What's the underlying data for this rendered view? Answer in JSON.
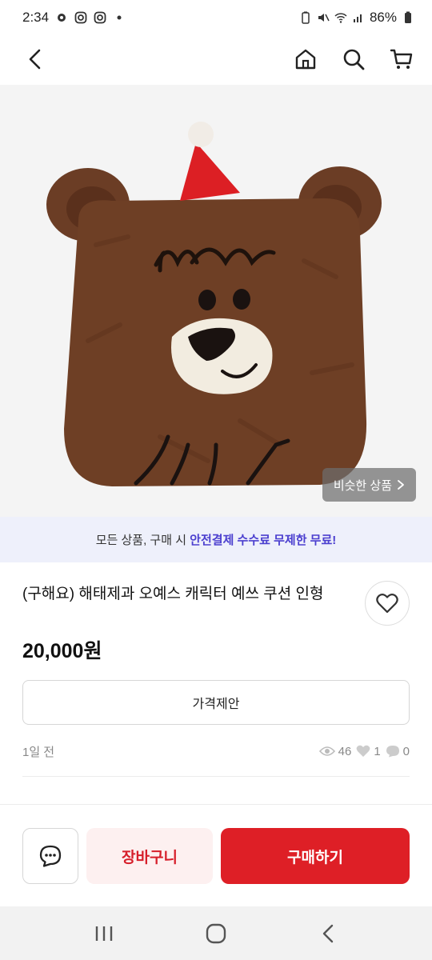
{
  "status_bar": {
    "time": "2:34",
    "battery": "86%",
    "left_icons": [
      "gear-icon",
      "instagram-icon",
      "instagram-icon",
      "dot-icon"
    ],
    "right_icons": [
      "battery-saver-icon",
      "mute-icon",
      "wifi-icon",
      "signal-icon",
      "battery-icon"
    ]
  },
  "nav": {
    "back_icon": "chevron-left-icon",
    "home_icon": "home-icon",
    "search_icon": "search-icon",
    "cart_icon": "cart-icon"
  },
  "product_image": {
    "similar_label": "비슷한 상품"
  },
  "promo": {
    "prefix": "모든 상품, 구매 시 ",
    "highlight": "안전결제 수수료 무제한 무료!",
    "highlight_color": "#4b3fcf"
  },
  "product": {
    "title": "(구해요) 해태제과 오예스 캐릭터 예쓰 쿠션 인형",
    "price": "20,000원",
    "offer_label": "가격제안",
    "posted": "1일 전",
    "views": "46",
    "likes": "1",
    "chats": "0"
  },
  "actions": {
    "chat_icon": "chat-icon",
    "cart_label": "장바구니",
    "buy_label": "구매하기",
    "buy_color": "#de1f26"
  },
  "android_nav": {
    "recents_icon": "recents-icon",
    "home_icon": "home-circle-icon",
    "back_icon": "back-icon"
  }
}
